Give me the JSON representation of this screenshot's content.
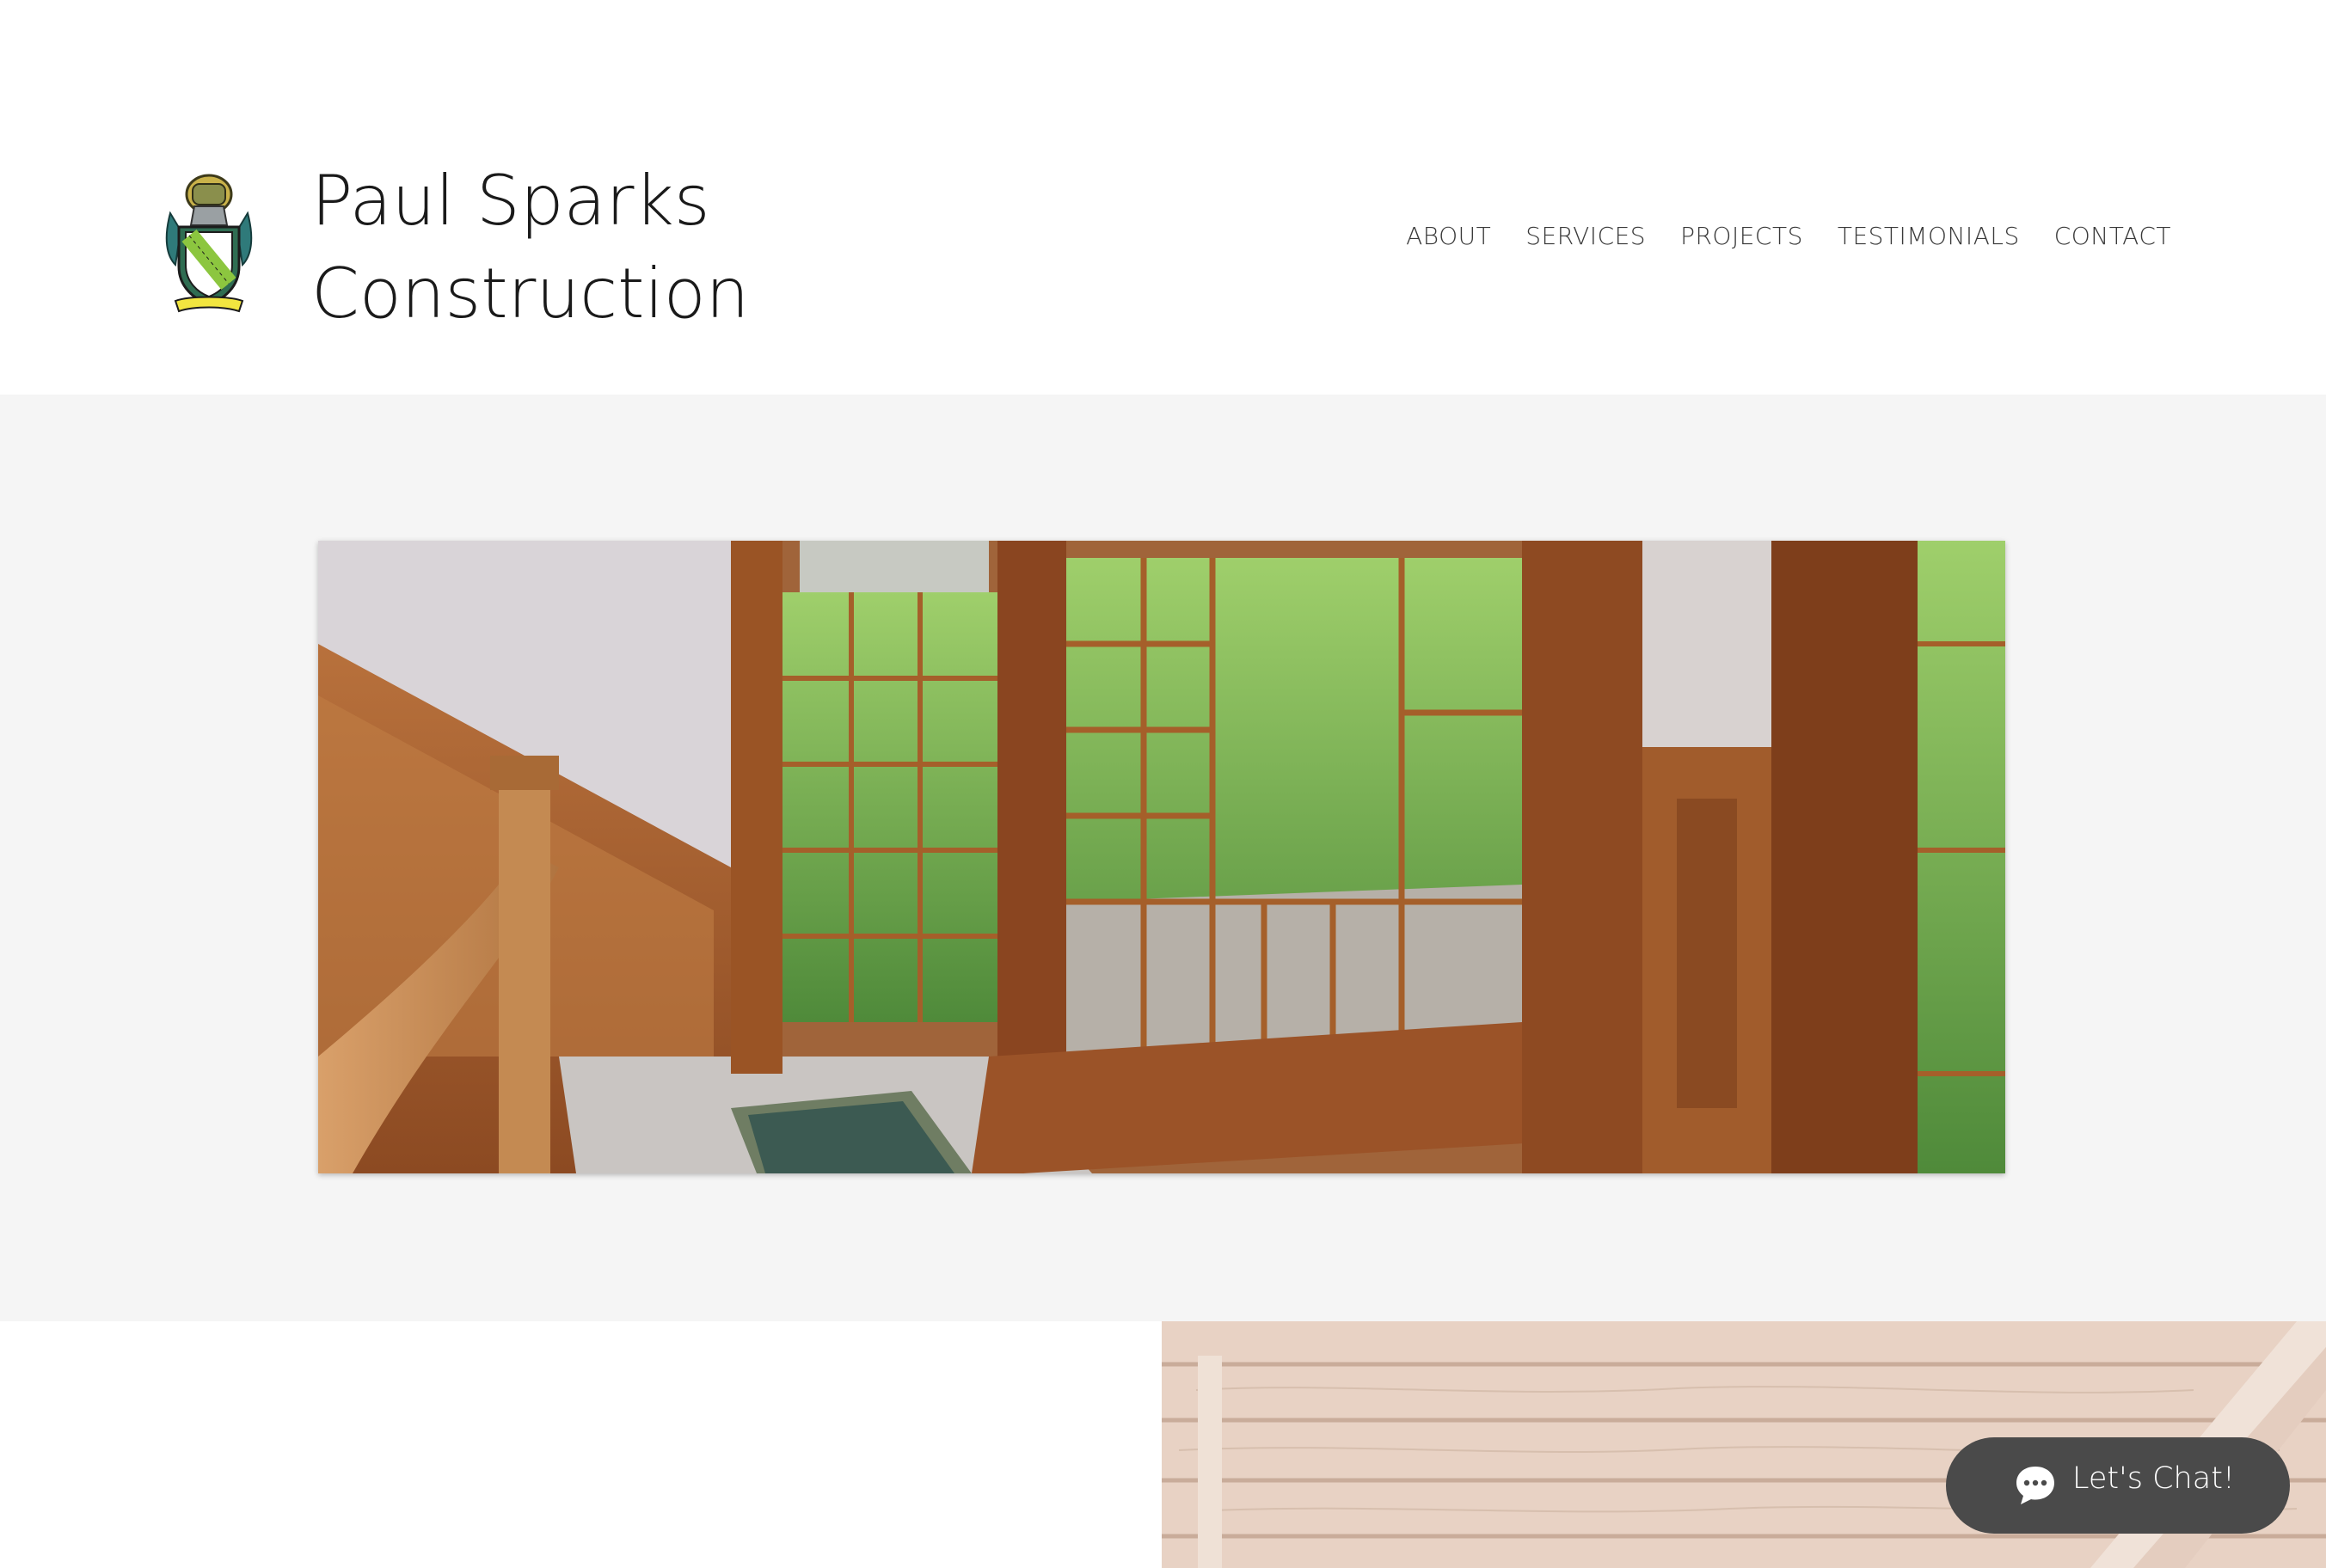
{
  "header": {
    "brand_line1": "Paul Sparks",
    "brand_line2": "Construction",
    "logo_icon": "family-crest-shield-icon"
  },
  "nav": {
    "items": [
      {
        "label": "ABOUT"
      },
      {
        "label": "SERVICES"
      },
      {
        "label": "PROJECTS"
      },
      {
        "label": "TESTIMONIALS"
      },
      {
        "label": "CONTACT"
      }
    ]
  },
  "hero": {
    "image_subject": "wood-paneled-staircase-landing-with-bay-windows"
  },
  "lower": {
    "image_subject": "wood-framing-lumber"
  },
  "chat": {
    "label": "Let's Chat!",
    "icon": "chat-bubble-icon"
  },
  "colors": {
    "header_bg": "#ffffff",
    "hero_band_bg": "#f5f5f5",
    "text_dark": "#1a1a1a",
    "nav_text": "#3a3a3a",
    "chat_bg": "#4a4a4a",
    "chat_text": "#ffffff"
  }
}
